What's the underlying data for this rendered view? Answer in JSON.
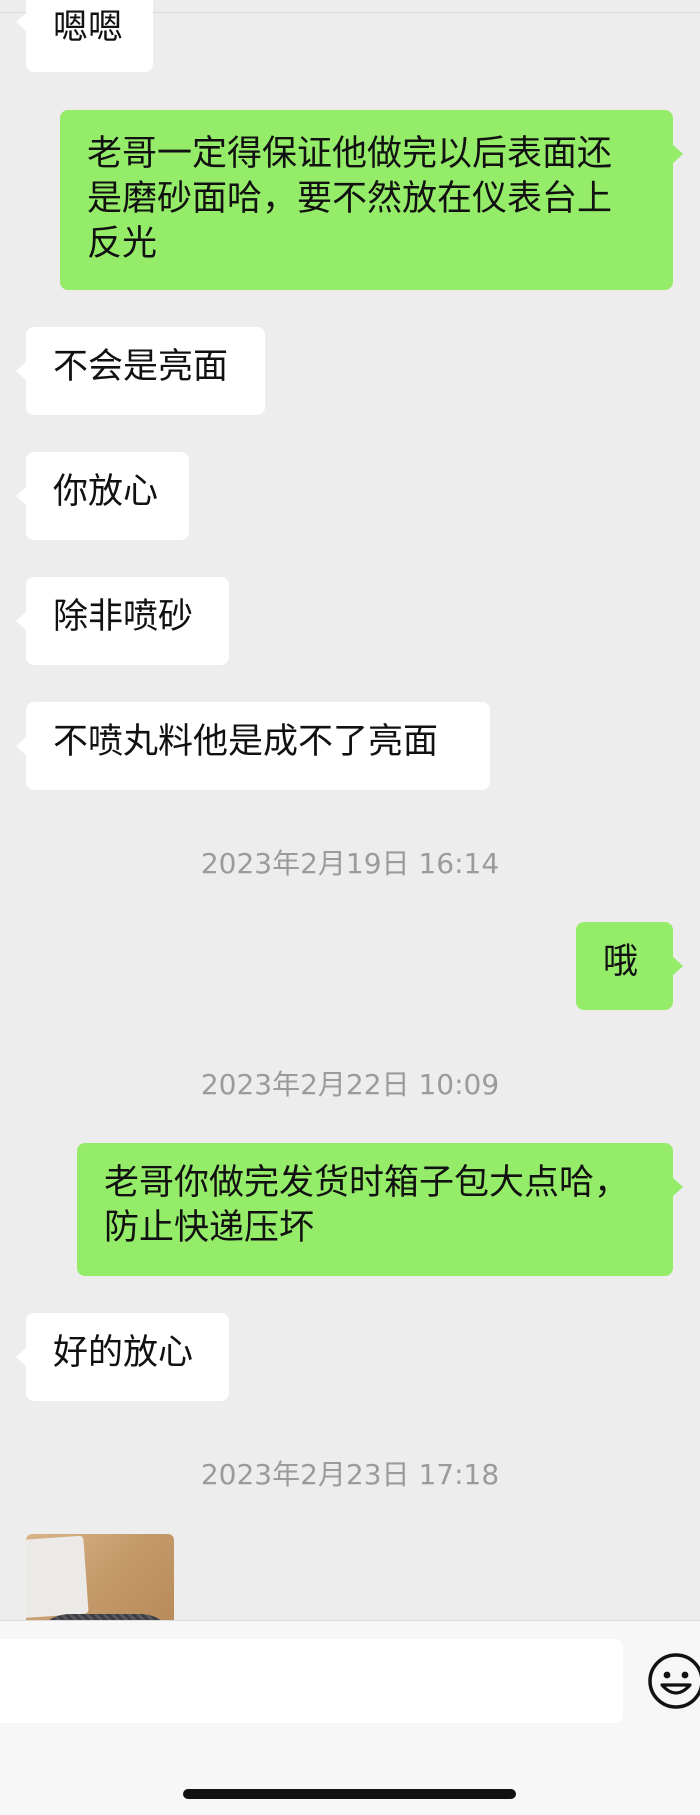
{
  "messages": [
    {
      "side": "left",
      "text": "嗯嗯"
    },
    {
      "side": "right",
      "text": "老哥一定得保证他做完以后表面还是磨砂面哈，要不然放在仪表台上反光"
    },
    {
      "side": "left",
      "text": "不会是亮面"
    },
    {
      "side": "left",
      "text": "你放心"
    },
    {
      "side": "left",
      "text": "除非喷砂"
    },
    {
      "side": "left",
      "text": "不喷丸料他是成不了亮面"
    },
    {
      "side": "right",
      "text": "哦"
    },
    {
      "side": "right",
      "text": "老哥你做完发货时箱子包大点哈，防止快递压坏"
    },
    {
      "side": "left",
      "text": "好的放心"
    }
  ],
  "timestamps": [
    "2023年2月19日 16:14",
    "2023年2月22日 10:09",
    "2023年2月23日 17:18"
  ],
  "input_bar": {
    "placeholder": "",
    "emoji_icon": "emoji-icon"
  },
  "colors": {
    "background": "#ededed",
    "bubble_self": "#95ec69",
    "bubble_other": "#ffffff",
    "timestamp_text": "#9b9b9b"
  }
}
